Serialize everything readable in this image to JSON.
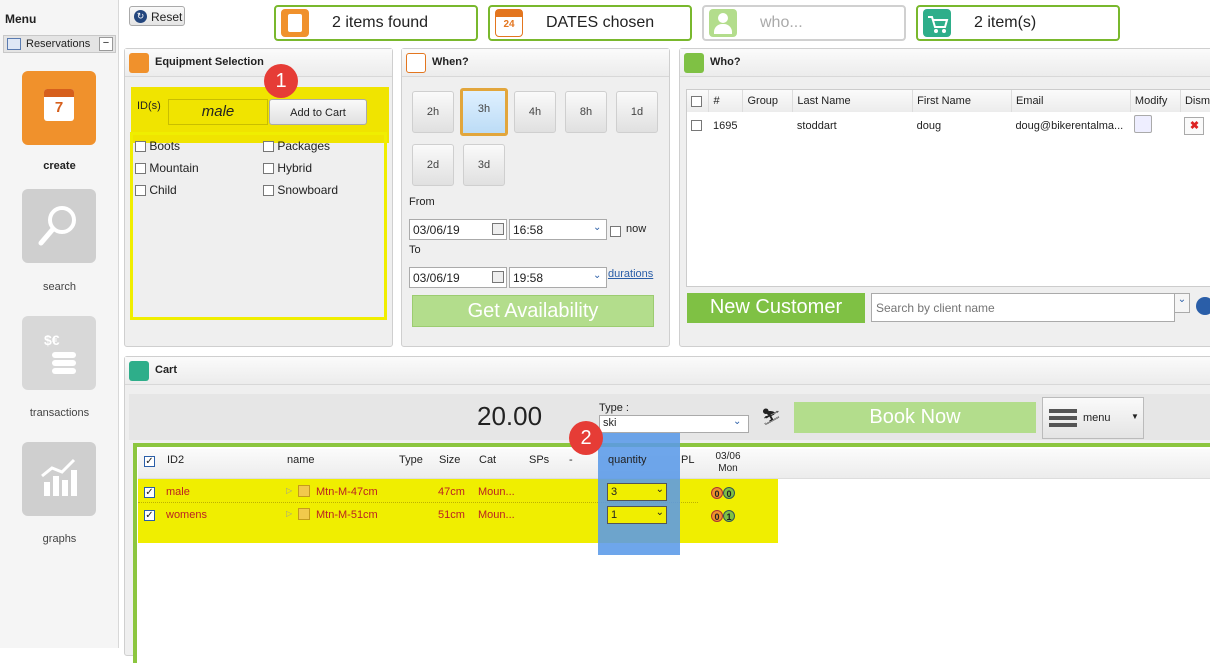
{
  "menu": {
    "title": "Menu",
    "reservations_label": "Reservations",
    "items": [
      {
        "label": "create",
        "icon": "calendar-icon",
        "day": "7"
      },
      {
        "label": "search",
        "icon": "magnifier-icon"
      },
      {
        "label": "transactions",
        "icon": "coins-icon",
        "symbol": "$€"
      },
      {
        "label": "graphs",
        "icon": "chart-icon"
      }
    ]
  },
  "topbar": {
    "reset_label": "Reset",
    "items_found": "2 items found",
    "dates_chosen": "DATES chosen",
    "who": "who...",
    "cart_items": "2 item(s)",
    "calendar_day": "24"
  },
  "equipment": {
    "title": "Equipment Selection",
    "id_label": "ID(s)",
    "id_value": "male",
    "add_to_cart_label": "Add to Cart",
    "filters": [
      {
        "label": "Boots"
      },
      {
        "label": "Packages"
      },
      {
        "label": "Mountain"
      },
      {
        "label": "Hybrid"
      },
      {
        "label": "Child"
      },
      {
        "label": "Snowboard"
      }
    ]
  },
  "when": {
    "title": "When?",
    "durations": [
      "2h",
      "3h",
      "4h",
      "8h",
      "1d",
      "2d",
      "3d"
    ],
    "selected_duration": "3h",
    "from_label": "From",
    "from_date": "03/06/19",
    "from_time": "16:58",
    "now_label": "now",
    "to_label": "To",
    "to_date": "03/06/19",
    "to_time": "19:58",
    "durations_link": "durations",
    "get_availability_label": "Get Availability"
  },
  "who": {
    "title": "Who?",
    "columns": [
      "#",
      "Group",
      "Last Name",
      "First Name",
      "Email",
      "Modify",
      "Dism"
    ],
    "rows": [
      {
        "num": "1695",
        "group": "",
        "last": "stoddart",
        "first": "doug",
        "email": "doug@bikerentalma..."
      }
    ],
    "new_customer_label": "New Customer",
    "search_placeholder": "Search by client name"
  },
  "cart": {
    "title": "Cart",
    "total": "20.00",
    "type_label": "Type :",
    "type_value": "ski",
    "book_now_label": "Book Now",
    "menu_label": "menu",
    "columns": [
      "ID2",
      "name",
      "Type",
      "Size",
      "Cat",
      "SPs",
      "-",
      "quantity",
      "PL"
    ],
    "date_col": {
      "date": "03/06",
      "day": "Mon"
    },
    "rows": [
      {
        "id2": "male",
        "name": "Mtn-M-47cm",
        "type": "",
        "size": "47cm",
        "cat": "Moun...",
        "qty": "3",
        "b1": "0",
        "b2": "0"
      },
      {
        "id2": "womens",
        "name": "Mtn-M-51cm",
        "type": "",
        "size": "51cm",
        "cat": "Moun...",
        "qty": "1",
        "b1": "0",
        "b2": "1"
      }
    ]
  },
  "annotations": {
    "one": "1",
    "two": "2"
  },
  "colors": {
    "accent_green": "#79b82d",
    "highlight_yellow": "#f0ee00",
    "highlight_blue": "#5599ee",
    "annotation_red": "#e63c36",
    "tile_orange": "#f0912c"
  }
}
